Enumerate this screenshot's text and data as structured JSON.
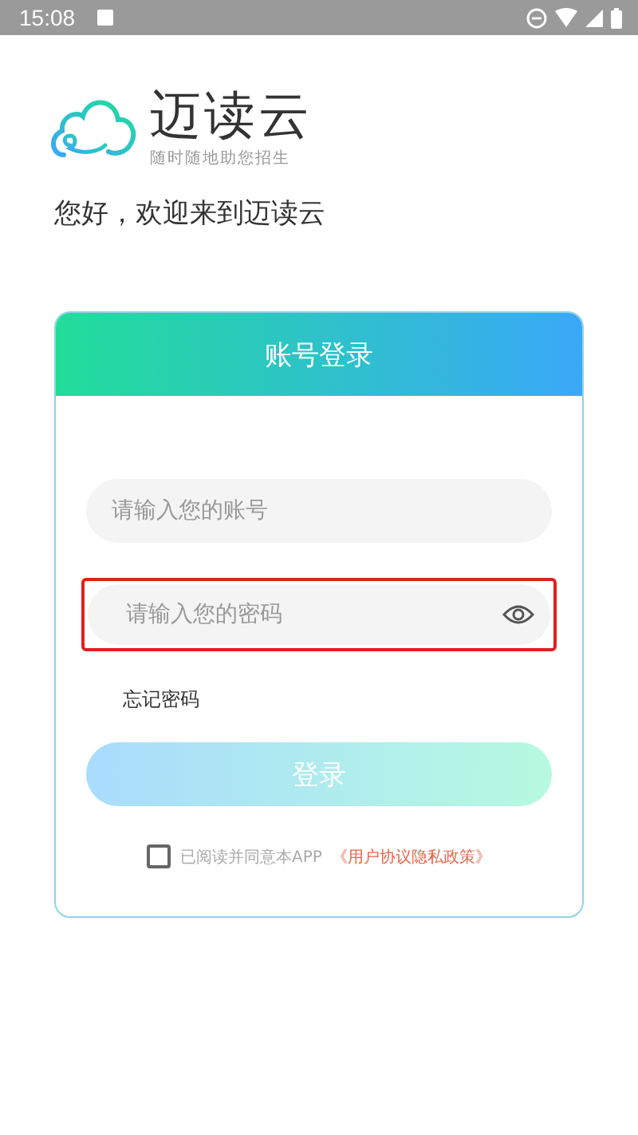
{
  "status_bar": {
    "time": "15:08"
  },
  "logo": {
    "name": "迈读云",
    "tagline": "随时随地助您招生"
  },
  "welcome": "您好，欢迎来到迈读云",
  "card": {
    "title": "账号登录",
    "account_field": {
      "placeholder": "请输入您的账号"
    },
    "password_field": {
      "placeholder": "请输入您的密码",
      "highlighted": true
    },
    "forgot_link": "忘记密码",
    "login_button": {
      "label": "登录",
      "disabled": true
    },
    "agreement": {
      "checked": false,
      "text": "已阅读并同意本APP",
      "link": "《用户协议隐私政策》"
    }
  }
}
